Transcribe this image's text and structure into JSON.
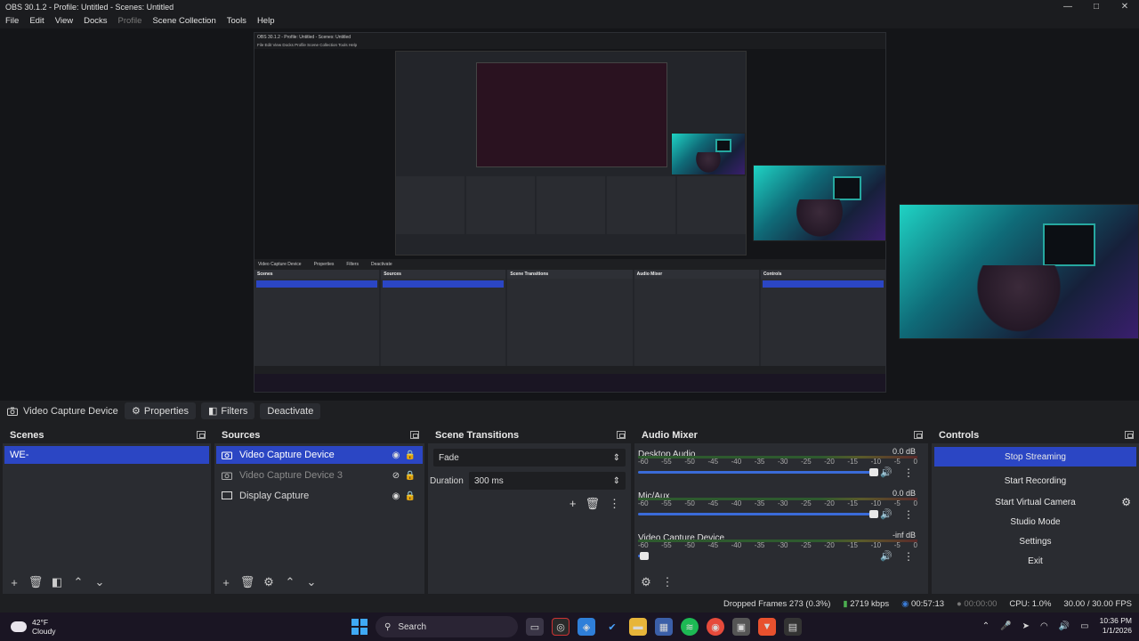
{
  "window": {
    "title": "OBS 30.1.2 - Profile: Untitled - Scenes: Untitled",
    "minimize": "—",
    "maximize": "□",
    "close": "✕"
  },
  "menu": {
    "file": "File",
    "edit": "Edit",
    "view": "View",
    "docks": "Docks",
    "profile": "Profile",
    "scene_collection": "Scene Collection",
    "tools": "Tools",
    "help": "Help"
  },
  "nested_preview": {
    "title": "OBS 30.1.2 - Profile: Untitled - Scenes: Untitled",
    "menu": "File  Edit  View  Docks  Profile  Scene Collection  Tools  Help",
    "source_bar": [
      "Video Capture Device",
      "Properties",
      "Filters",
      "Deactivate"
    ],
    "panels": [
      "Scenes",
      "Sources",
      "Scene Transitions",
      "Audio Mixer",
      "Controls"
    ]
  },
  "source_toolbar": {
    "source_name": "Video Capture Device",
    "properties": "Properties",
    "filters": "Filters",
    "deactivate": "Deactivate"
  },
  "scenes": {
    "title": "Scenes",
    "items": [
      {
        "label": "WE-"
      }
    ]
  },
  "sources": {
    "title": "Sources",
    "items": [
      {
        "label": "Video Capture Device"
      },
      {
        "label": "Video Capture Device 3"
      },
      {
        "label": "Display Capture"
      }
    ]
  },
  "transitions": {
    "title": "Scene Transitions",
    "selected": "Fade",
    "duration_label": "Duration",
    "duration_value": "300 ms"
  },
  "mixer": {
    "title": "Audio Mixer",
    "scale": [
      "-60",
      "-55",
      "-50",
      "-45",
      "-40",
      "-35",
      "-30",
      "-25",
      "-20",
      "-15",
      "-10",
      "-5",
      "0"
    ],
    "channels": [
      {
        "name": "Desktop Audio",
        "db": "0.0 dB",
        "volume": 0.98
      },
      {
        "name": "Mic/Aux",
        "db": "0.0 dB",
        "volume": 0.98
      },
      {
        "name": "Video Capture Device",
        "db": "-inf dB",
        "volume": 0.02
      }
    ]
  },
  "controls": {
    "title": "Controls",
    "stop_streaming": "Stop Streaming",
    "start_recording": "Start Recording",
    "start_virtual_camera": "Start Virtual Camera",
    "studio_mode": "Studio Mode",
    "settings": "Settings",
    "exit": "Exit"
  },
  "status": {
    "dropped_frames": "Dropped Frames 273 (0.3%)",
    "bitrate": "2719 kbps",
    "stream_time": "00:57:13",
    "rec_time": "00:00:00",
    "cpu": "CPU: 1.0%",
    "fps": "30.00 / 30.00 FPS"
  },
  "taskbar": {
    "temp": "42°F",
    "condition": "Cloudy",
    "search": "Search",
    "time": "10:36 PM",
    "date": "1/1/2026"
  },
  "colors": {
    "accent": "#2b46c4",
    "panel": "#2a2c31",
    "background": "#1e1f22"
  }
}
